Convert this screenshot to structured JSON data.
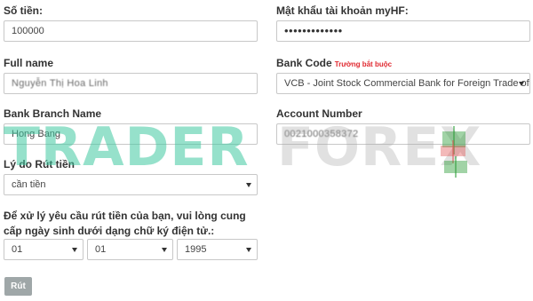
{
  "form": {
    "amount": {
      "label": "Số tiền:",
      "value": "100000"
    },
    "password": {
      "label": "Mật khẩu tài khoản myHF:",
      "value": "•••••••••••••"
    },
    "full_name": {
      "label": "Full name",
      "value": "Nguyễn Thị Hoa Linh"
    },
    "bank_code": {
      "label": "Bank Code",
      "required_note": "Trường bắt buộc",
      "value": "VCB - Joint Stock Commercial Bank for Foreign Trade of Vietnam"
    },
    "bank_branch": {
      "label": "Bank Branch Name",
      "value": "Hong Bang"
    },
    "account_number": {
      "label": "Account Number",
      "value": "0021000358372"
    },
    "reason": {
      "label": "Lý do Rút tiền",
      "value": "cần tiền"
    },
    "dob": {
      "prompt": "Để xử lý yêu cầu rút tiền của bạn, vui lòng cung cấp ngày sinh dưới dạng chữ ký điện tử.:",
      "day": "01",
      "month": "01",
      "year": "1995"
    },
    "submit_label": "Rút"
  },
  "watermark": {
    "text_left": "TRADER",
    "text_right": "FOREX",
    "colors": {
      "left": "#40c8a0",
      "right": "#aaaaaa",
      "candle_green": "#2e9e3a",
      "candle_red": "#e05050"
    }
  }
}
